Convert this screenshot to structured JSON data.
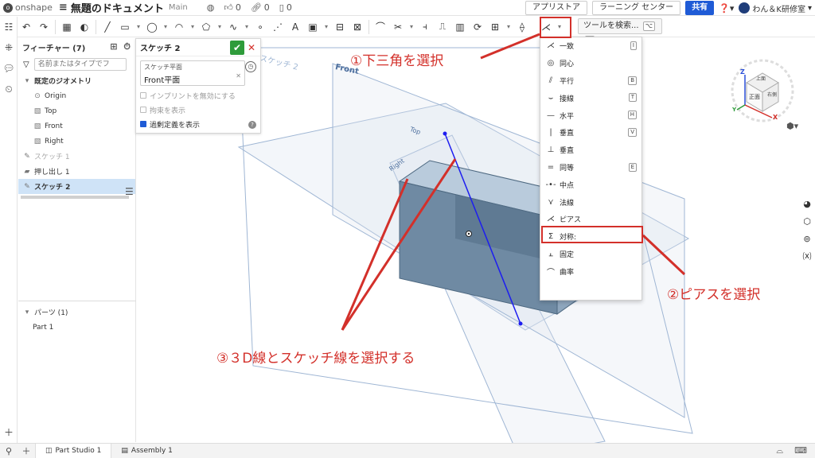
{
  "app": {
    "logo_text": "onshape",
    "document_title": "無題のドキュメント",
    "branch": "Main",
    "likes": "0",
    "links": "0",
    "copies": "0"
  },
  "header_buttons": {
    "app_store": "アプリストア",
    "learning_center": "ラーニング センター",
    "share": "共有",
    "user_name": "わん＆K研修室"
  },
  "toolbar": {
    "search_label": "ツールを検索...",
    "search_key1": "⌥",
    "search_key2": "C"
  },
  "feature_panel": {
    "title": "フィーチャー (7)",
    "filter_placeholder": "名前またはタイプでフ",
    "default_geometry": "既定のジオメトリ",
    "items": [
      {
        "label": "Origin"
      },
      {
        "label": "Top"
      },
      {
        "label": "Front"
      },
      {
        "label": "Right"
      },
      {
        "label": "スケッチ 1"
      },
      {
        "label": "押し出し 1"
      },
      {
        "label": "スケッチ 2"
      }
    ],
    "parts_label": "パーツ (1)",
    "part_name": "Part 1"
  },
  "sketch_dialog": {
    "title": "スケッチ 2",
    "plane_label": "スケッチ平面",
    "plane_value": "Front平面",
    "opt_imprint": "インプリントを無効にする",
    "opt_constraints": "拘束を表示",
    "opt_overdefined": "過剰定義を表示"
  },
  "viewport_labels": {
    "sketch_label": "スケッチ 2",
    "front": "Front",
    "top": "Top",
    "right": "Right"
  },
  "constraint_menu": [
    {
      "label": "一致",
      "glyph": "coincident-icon",
      "key": "I"
    },
    {
      "label": "同心",
      "glyph": "concentric-icon",
      "key": ""
    },
    {
      "label": "平行",
      "glyph": "parallel-icon",
      "key": "B"
    },
    {
      "label": "接線",
      "glyph": "tangent-icon",
      "key": "T"
    },
    {
      "label": "水平",
      "glyph": "horizontal-icon",
      "key": "H"
    },
    {
      "label": "垂直",
      "glyph": "vertical-icon",
      "key": "V"
    },
    {
      "label": "垂直",
      "glyph": "perpendicular-icon",
      "key": ""
    },
    {
      "label": "同等",
      "glyph": "equal-icon",
      "key": "E"
    },
    {
      "label": "中点",
      "glyph": "midpoint-icon",
      "key": ""
    },
    {
      "label": "法線",
      "glyph": "normal-icon",
      "key": ""
    },
    {
      "label": "ピアス",
      "glyph": "pierce-icon",
      "key": ""
    },
    {
      "label": "対称:",
      "glyph": "symmetric-icon",
      "key": ""
    },
    {
      "label": "固定",
      "glyph": "fix-icon",
      "key": ""
    },
    {
      "label": "曲率",
      "glyph": "curvature-icon",
      "key": ""
    }
  ],
  "annotations": {
    "step1": "①下三角を選択",
    "step2": "②ピアスを選択",
    "step3": "③３D線とスケッチ線を選択する"
  },
  "viewcube": {
    "top": "上面",
    "front": "正面",
    "right": "右側",
    "axis_x": "X",
    "axis_y": "Y",
    "axis_z": "Z"
  },
  "bottom_tabs": [
    {
      "label": "Part Studio 1"
    },
    {
      "label": "Assembly 1"
    }
  ],
  "colors": {
    "accent_red": "#d3302a",
    "share_blue": "#1f5bd6",
    "ok_green": "#2e9b3a",
    "selection_blue": "#cfe3f7",
    "plane_blue": "#9fb6d4",
    "box_face": "#6f8aa3",
    "line_blue": "#1d1df0"
  }
}
